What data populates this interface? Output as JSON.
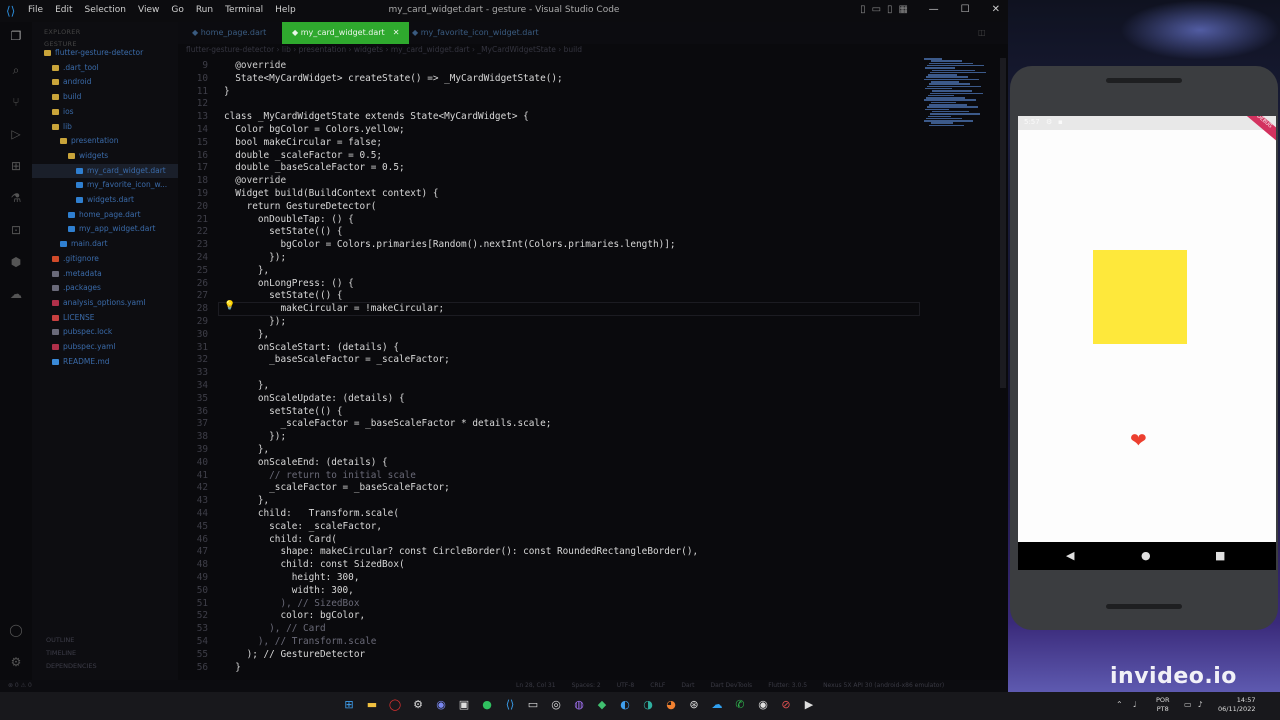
{
  "window": {
    "title": "my_card_widget.dart - gesture - Visual Studio Code",
    "menu": [
      "File",
      "Edit",
      "Selection",
      "View",
      "Go",
      "Run",
      "Terminal",
      "Help"
    ]
  },
  "sidebar": {
    "header": "EXPLORER",
    "section": "GESTURE",
    "tree": [
      {
        "label": "flutter-gesture-detector",
        "kind": "folder",
        "indent": 0
      },
      {
        "label": ".dart_tool",
        "kind": "folder",
        "indent": 1
      },
      {
        "label": "android",
        "kind": "folder",
        "indent": 1
      },
      {
        "label": "build",
        "kind": "folder",
        "indent": 1
      },
      {
        "label": "ios",
        "kind": "folder",
        "indent": 1
      },
      {
        "label": "lib",
        "kind": "folder",
        "indent": 1
      },
      {
        "label": "presentation",
        "kind": "folder",
        "indent": 2
      },
      {
        "label": "widgets",
        "kind": "folder",
        "indent": 3
      },
      {
        "label": "my_card_widget.dart",
        "kind": "dart",
        "indent": 4,
        "selected": true
      },
      {
        "label": "my_favorite_icon_w...",
        "kind": "dart",
        "indent": 4
      },
      {
        "label": "widgets.dart",
        "kind": "dart",
        "indent": 4
      },
      {
        "label": "home_page.dart",
        "kind": "dart",
        "indent": 3
      },
      {
        "label": "my_app_widget.dart",
        "kind": "dart",
        "indent": 3
      },
      {
        "label": "main.dart",
        "kind": "dart",
        "indent": 2
      },
      {
        "label": ".gitignore",
        "kind": "git",
        "indent": 1
      },
      {
        "label": ".metadata",
        "kind": "meta",
        "indent": 1
      },
      {
        "label": ".packages",
        "kind": "meta",
        "indent": 1
      },
      {
        "label": "analysis_options.yaml",
        "kind": "yaml",
        "indent": 1
      },
      {
        "label": "LICENSE",
        "kind": "lic",
        "indent": 1
      },
      {
        "label": "pubspec.lock",
        "kind": "meta",
        "indent": 1
      },
      {
        "label": "pubspec.yaml",
        "kind": "yaml",
        "indent": 1
      },
      {
        "label": "README.md",
        "kind": "info",
        "indent": 1
      }
    ],
    "bottom": [
      "OUTLINE",
      "TIMELINE",
      "DEPENDENCIES"
    ]
  },
  "tabs": [
    {
      "label": "home_page.dart",
      "active": false
    },
    {
      "label": "my_card_widget.dart",
      "active": true
    },
    {
      "label": "my_favorite_icon_widget.dart",
      "active": false
    }
  ],
  "breadcrumb": "flutter-gesture-detector › lib › presentation › widgets › my_card_widget.dart › _MyCardWidgetState › build",
  "code": [
    {
      "n": "9",
      "t": "  @override"
    },
    {
      "n": "10",
      "t": "  State<MyCardWidget> createState() => _MyCardWidgetState();"
    },
    {
      "n": "11",
      "t": "}"
    },
    {
      "n": "12",
      "t": ""
    },
    {
      "n": "13",
      "t": "class _MyCardWidgetState extends State<MyCardWidget> {"
    },
    {
      "n": "14",
      "t": "  Color bgColor = Colors.yellow;"
    },
    {
      "n": "15",
      "t": "  bool makeCircular = false;"
    },
    {
      "n": "16",
      "t": "  double _scaleFactor = 0.5;"
    },
    {
      "n": "17",
      "t": "  double _baseScaleFactor = 0.5;"
    },
    {
      "n": "18",
      "t": "  @override"
    },
    {
      "n": "19",
      "t": "  Widget build(BuildContext context) {"
    },
    {
      "n": "20",
      "t": "    return GestureDetector("
    },
    {
      "n": "21",
      "t": "      onDoubleTap: () {"
    },
    {
      "n": "22",
      "t": "        setState(() {"
    },
    {
      "n": "23",
      "t": "          bgColor = Colors.primaries[Random().nextInt(Colors.primaries.length)];"
    },
    {
      "n": "24",
      "t": "        });"
    },
    {
      "n": "25",
      "t": "      },"
    },
    {
      "n": "26",
      "t": "      onLongPress: () {"
    },
    {
      "n": "27",
      "t": "        setState(() {"
    },
    {
      "n": "28",
      "t": "          makeCircular = !makeCircular;"
    },
    {
      "n": "29",
      "t": "        });"
    },
    {
      "n": "30",
      "t": "      },"
    },
    {
      "n": "31",
      "t": "      onScaleStart: (details) {"
    },
    {
      "n": "32",
      "t": "        _baseScaleFactor = _scaleFactor;"
    },
    {
      "n": "33",
      "t": ""
    },
    {
      "n": "34",
      "t": "      },"
    },
    {
      "n": "35",
      "t": "      onScaleUpdate: (details) {"
    },
    {
      "n": "36",
      "t": "        setState(() {"
    },
    {
      "n": "37",
      "t": "          _scaleFactor = _baseScaleFactor * details.scale;"
    },
    {
      "n": "38",
      "t": "        });"
    },
    {
      "n": "39",
      "t": "      },"
    },
    {
      "n": "40",
      "t": "      onScaleEnd: (details) {"
    },
    {
      "n": "41",
      "t": "        // return to initial scale"
    },
    {
      "n": "42",
      "t": "        _scaleFactor = _baseScaleFactor;"
    },
    {
      "n": "43",
      "t": "      },"
    },
    {
      "n": "44",
      "t": "      child:   Transform.scale("
    },
    {
      "n": "45",
      "t": "        scale: _scaleFactor,"
    },
    {
      "n": "46",
      "t": "        child: Card("
    },
    {
      "n": "47",
      "t": "          shape: makeCircular? const CircleBorder(): const RoundedRectangleBorder(),"
    },
    {
      "n": "48",
      "t": "          child: const SizedBox("
    },
    {
      "n": "49",
      "t": "            height: 300,"
    },
    {
      "n": "50",
      "t": "            width: 300,"
    },
    {
      "n": "51",
      "t": "          ), // SizedBox"
    },
    {
      "n": "52",
      "t": "          color: bgColor,"
    },
    {
      "n": "53",
      "t": "        ), // Card"
    },
    {
      "n": "54",
      "t": "      ), // Transform.scale"
    },
    {
      "n": "55",
      "t": "    ); // GestureDetector"
    },
    {
      "n": "56",
      "t": "  }"
    }
  ],
  "statusbar": {
    "left": "⊗ 0 ⚠ 0",
    "right": [
      "Ln 28, Col 31",
      "Spaces: 2",
      "UTF-8",
      "CRLF",
      "Dart",
      "Dart DevTools",
      "Flutter: 3.0.5",
      "Nexus 5X API 30 (android-x86 emulator)"
    ]
  },
  "phone": {
    "status_time": "5:57",
    "debug_banner": "DEBUG",
    "square_color": "#fee83b",
    "heart_color": "#ec3f2f"
  },
  "watermark": "invideo.io",
  "taskbar": {
    "lang_top": "POR",
    "lang_bottom": "PT8",
    "time": "14:57",
    "date": "06/11/2022"
  }
}
